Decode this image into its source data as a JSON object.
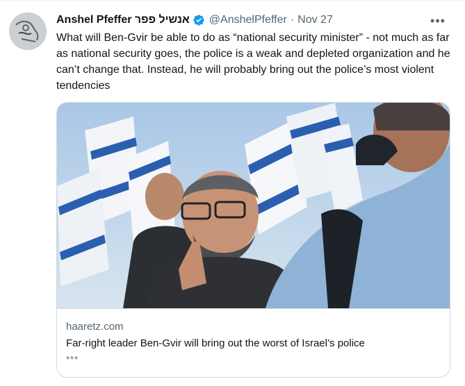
{
  "tweet": {
    "author_name": "Anshel Pfeffer אנשיל פפר",
    "handle": "@AnshelPfeffer",
    "separator": "·",
    "timestamp": "Nov 27",
    "more_label": "•••",
    "text": "What will Ben-Gvir be able to do as “national security minister” - not much as far as national security goes, the police is a weak and depleted organization and he can’t change that. Instead, he will probably bring out the police’s most violent tendencies",
    "verified": true,
    "verified_color": "#1d9bf0"
  },
  "card": {
    "domain": "haaretz.com",
    "title": "Far-right leader Ben-Gvir will bring out the worst of Israel’s police",
    "description": "***"
  },
  "icons": {
    "verified": "verified-badge-icon",
    "more": "more-options-icon"
  }
}
